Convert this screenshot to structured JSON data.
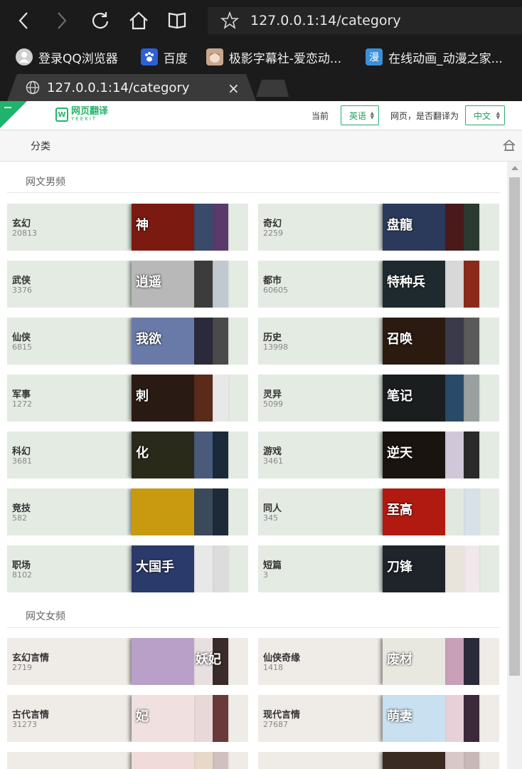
{
  "browser": {
    "url": "127.0.0.1:14/category",
    "tab_title": "127.0.0.1:14/category",
    "tab_close": "×",
    "bookmarks": [
      {
        "label": "登录QQ浏览器",
        "icon": "qq-user-icon",
        "color": "#cfcfcf"
      },
      {
        "label": "百度",
        "icon": "baidu-paw-icon",
        "color": "#2e5fd8"
      },
      {
        "label": "极影字幕社-爱恋动...",
        "icon": "anime-avatar-icon",
        "color": "#c9a78f"
      },
      {
        "label": "在线动画_动漫之家...",
        "icon": "manhua-icon",
        "glyph": "漫",
        "color": "#3b8fd9"
      }
    ]
  },
  "translate_bar": {
    "logo_text": "网页翻译",
    "logo_sub": "YEEKIT",
    "current_label": "当前",
    "source_lang": "英语",
    "prompt_label": "网页，是否翻译为",
    "target_lang": "中文"
  },
  "page": {
    "header_title": "分类",
    "sections": [
      {
        "title": "网文男频",
        "categories": [
          {
            "name": "玄幻",
            "count": "20813",
            "bg": "#e3ebe3",
            "covers": [
              {
                "c": "#7a1a10",
                "t": "神"
              },
              {
                "c": "#3a4a6a",
                "t": ""
              },
              {
                "c": "#5a3a6a",
                "t": ""
              }
            ]
          },
          {
            "name": "奇幻",
            "count": "2259",
            "bg": "#e3ebe3",
            "covers": [
              {
                "c": "#2b3a5a",
                "t": "盘龍"
              },
              {
                "c": "#4a1a1a",
                "t": ""
              },
              {
                "c": "#2a3a30",
                "t": ""
              }
            ]
          },
          {
            "name": "武侠",
            "count": "3376",
            "bg": "#e3ebe3",
            "covers": [
              {
                "c": "#b8b8b8",
                "t": "逍遥"
              },
              {
                "c": "#3c3c3c",
                "t": ""
              },
              {
                "c": "#c0c8d0",
                "t": ""
              }
            ]
          },
          {
            "name": "都市",
            "count": "60605",
            "bg": "#e3ebe3",
            "covers": [
              {
                "c": "#1e2a2e",
                "t": "特种兵"
              },
              {
                "c": "#d8d8d8",
                "t": ""
              },
              {
                "c": "#8a2a1a",
                "t": ""
              }
            ]
          },
          {
            "name": "仙侠",
            "count": "6815",
            "bg": "#e3ebe3",
            "covers": [
              {
                "c": "#6a7aa8",
                "t": "我欲"
              },
              {
                "c": "#2a2a3a",
                "t": ""
              },
              {
                "c": "#4a4a4a",
                "t": ""
              }
            ]
          },
          {
            "name": "历史",
            "count": "13998",
            "bg": "#e3ebe3",
            "covers": [
              {
                "c": "#2a1a10",
                "t": "召唤"
              },
              {
                "c": "#3a3a4a",
                "t": ""
              },
              {
                "c": "#5a5a5a",
                "t": ""
              }
            ]
          },
          {
            "name": "军事",
            "count": "1272",
            "bg": "#e3ebe3",
            "covers": [
              {
                "c": "#2a1a14",
                "t": "刺"
              },
              {
                "c": "#5a2a1a",
                "t": ""
              },
              {
                "c": "#e8e8e8",
                "t": ""
              }
            ]
          },
          {
            "name": "灵异",
            "count": "5099",
            "bg": "#e3ebe3",
            "covers": [
              {
                "c": "#1a1e1e",
                "t": "笔记"
              },
              {
                "c": "#2a4a6a",
                "t": ""
              },
              {
                "c": "#9aa0a0",
                "t": ""
              }
            ]
          },
          {
            "name": "科幻",
            "count": "3681",
            "bg": "#e3ebe3",
            "covers": [
              {
                "c": "#2a2a1a",
                "t": "化"
              },
              {
                "c": "#4a5a7a",
                "t": ""
              },
              {
                "c": "#1a2a3a",
                "t": ""
              }
            ]
          },
          {
            "name": "游戏",
            "count": "3461",
            "bg": "#e3ebe3",
            "covers": [
              {
                "c": "#1a1410",
                "t": "逆天"
              },
              {
                "c": "#d0c8d8",
                "t": ""
              },
              {
                "c": "#2a2a2a",
                "t": ""
              }
            ]
          },
          {
            "name": "竞技",
            "count": "582",
            "bg": "#e3ebe3",
            "covers": [
              {
                "c": "#c89a10",
                "t": ""
              },
              {
                "c": "#3a4a5a",
                "t": ""
              },
              {
                "c": "#1e2a38",
                "t": ""
              }
            ]
          },
          {
            "name": "同人",
            "count": "345",
            "bg": "#e3ebe3",
            "covers": [
              {
                "c": "#b01a10",
                "t": "至高"
              },
              {
                "c": "#e0e8e0",
                "t": ""
              },
              {
                "c": "#d8e0e8",
                "t": ""
              }
            ]
          },
          {
            "name": "职场",
            "count": "8102",
            "bg": "#e3ebe3",
            "covers": [
              {
                "c": "#2a3a6a",
                "t": "大国手"
              },
              {
                "c": "#e8e8e8",
                "t": ""
              },
              {
                "c": "#dcdcdc",
                "t": ""
              }
            ]
          },
          {
            "name": "短篇",
            "count": "3",
            "bg": "#e3ebe3",
            "covers": [
              {
                "c": "#1e242a",
                "t": "刀锋"
              },
              {
                "c": "#e8e4dc",
                "t": ""
              },
              {
                "c": "#f0e8ea",
                "t": ""
              }
            ]
          }
        ]
      },
      {
        "title": "网文女频",
        "categories": [
          {
            "name": "玄幻言情",
            "count": "2719",
            "bg": "#efebe7",
            "covers": [
              {
                "c": "#b8a0c8",
                "t": ""
              },
              {
                "c": "#e8e0e0",
                "t": "妖妃"
              },
              {
                "c": "#3a2a2a",
                "t": ""
              }
            ]
          },
          {
            "name": "仙侠奇缘",
            "count": "1418",
            "bg": "#efebe7",
            "covers": [
              {
                "c": "#e8e8e0",
                "t": "废材"
              },
              {
                "c": "#c8a0b8",
                "t": ""
              },
              {
                "c": "#2a2a3a",
                "t": ""
              }
            ]
          },
          {
            "name": "古代言情",
            "count": "31273",
            "bg": "#efebe7",
            "covers": [
              {
                "c": "#f0e0e0",
                "t": "妃"
              },
              {
                "c": "#e8d8d8",
                "t": ""
              },
              {
                "c": "#6a3a3a",
                "t": ""
              }
            ]
          },
          {
            "name": "现代言情",
            "count": "27687",
            "bg": "#efebe7",
            "covers": [
              {
                "c": "#c8e0f0",
                "t": "萌妻"
              },
              {
                "c": "#e8d0d8",
                "t": ""
              },
              {
                "c": "#3a2a3a",
                "t": ""
              }
            ]
          },
          {
            "name": "",
            "count": "",
            "bg": "#efebe7",
            "covers": [
              {
                "c": "#f0dada",
                "t": ""
              },
              {
                "c": "#e8d8c8",
                "t": ""
              },
              {
                "c": "#d0c0c0",
                "t": ""
              }
            ]
          },
          {
            "name": "",
            "count": "",
            "bg": "#efebe7",
            "covers": [
              {
                "c": "#3a2a20",
                "t": ""
              },
              {
                "c": "#d8c8c8",
                "t": ""
              },
              {
                "c": "#c8b8b8",
                "t": ""
              }
            ]
          }
        ]
      }
    ]
  }
}
